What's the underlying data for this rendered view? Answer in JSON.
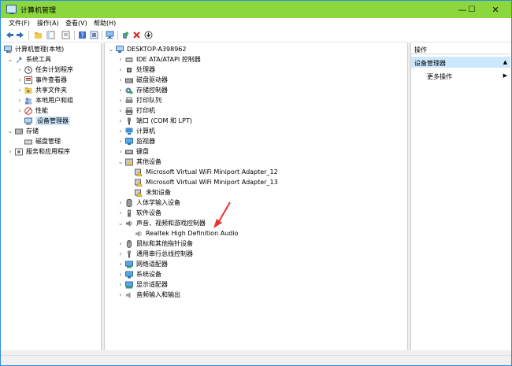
{
  "window": {
    "title": "计算机管理"
  },
  "window_controls": [
    "—",
    "☐",
    "✕"
  ],
  "menu": [
    "文件(F)",
    "操作(A)",
    "查看(V)",
    "帮助(H)"
  ],
  "toolbar_icons": [
    "back-arrow-icon",
    "forward-arrow-icon",
    "up-folder-icon",
    "show-hide-tree-icon",
    "export-list-icon",
    "help-icon",
    "properties-icon",
    "computer-scan-icon",
    "update-driver-icon",
    "uninstall-icon",
    "download-icon"
  ],
  "left_tree": [
    {
      "label": "计算机管理(本地)",
      "icon": "computer-management-icon"
    },
    {
      "label": "系统工具",
      "icon": "tools-icon"
    },
    {
      "label": "任务计划程序",
      "icon": "clock-icon"
    },
    {
      "label": "事件查看器",
      "icon": "event-viewer-icon"
    },
    {
      "label": "共享文件夹",
      "icon": "shared-folder-icon"
    },
    {
      "label": "本地用户和组",
      "icon": "users-icon"
    },
    {
      "label": "性能",
      "icon": "performance-icon"
    },
    {
      "label": "设备管理器",
      "icon": "device-manager-icon"
    },
    {
      "label": "存储",
      "icon": "storage-icon"
    },
    {
      "label": "磁盘管理",
      "icon": "disk-icon"
    },
    {
      "label": "服务和应用程序",
      "icon": "services-icon"
    }
  ],
  "device_tree": [
    {
      "label": "DESKTOP-A398962",
      "icon": "computer-icon"
    },
    {
      "label": "IDE ATA/ATAPI 控制器",
      "icon": "ide-controller-icon"
    },
    {
      "label": "处理器",
      "icon": "processor-icon"
    },
    {
      "label": "磁盘驱动器",
      "icon": "disk-drive-icon"
    },
    {
      "label": "存储控制器",
      "icon": "storage-controller-icon"
    },
    {
      "label": "打印队列",
      "icon": "print-queue-icon"
    },
    {
      "label": "打印机",
      "icon": "printer-icon"
    },
    {
      "label": "端口 (COM 和 LPT)",
      "icon": "port-icon"
    },
    {
      "label": "计算机",
      "icon": "computer-icon"
    },
    {
      "label": "监视器",
      "icon": "monitor-icon"
    },
    {
      "label": "键盘",
      "icon": "keyboard-icon"
    },
    {
      "label": "其他设备",
      "icon": "other-devices-icon"
    },
    {
      "label": "Microsoft Virtual WiFi Miniport Adapter_12",
      "icon": "warning-device-icon"
    },
    {
      "label": "Microsoft Virtual WiFi Miniport Adapter_13",
      "icon": "warning-device-icon"
    },
    {
      "label": "未知设备",
      "icon": "warning-device-icon"
    },
    {
      "label": "人体学输入设备",
      "icon": "hid-icon"
    },
    {
      "label": "软件设备",
      "icon": "software-device-icon"
    },
    {
      "label": "声音、视频和游戏控制器",
      "icon": "sound-icon"
    },
    {
      "label": "Realtek High Definition Audio",
      "icon": "speaker-icon"
    },
    {
      "label": "鼠标和其他指针设备",
      "icon": "mouse-icon"
    },
    {
      "label": "通用串行总线控制器",
      "icon": "usb-icon"
    },
    {
      "label": "网络适配器",
      "icon": "network-adapter-icon"
    },
    {
      "label": "系统设备",
      "icon": "system-device-icon"
    },
    {
      "label": "显示适配器",
      "icon": "display-adapter-icon"
    },
    {
      "label": "音频输入和输出",
      "icon": "audio-io-icon"
    }
  ],
  "actions": {
    "header": "操作",
    "selected": "设备管理器",
    "more": "更多操作"
  },
  "colors": {
    "titlebar": "#8cd63e",
    "selection": "#cce8ff",
    "annotation_arrow": "#e8312f"
  }
}
